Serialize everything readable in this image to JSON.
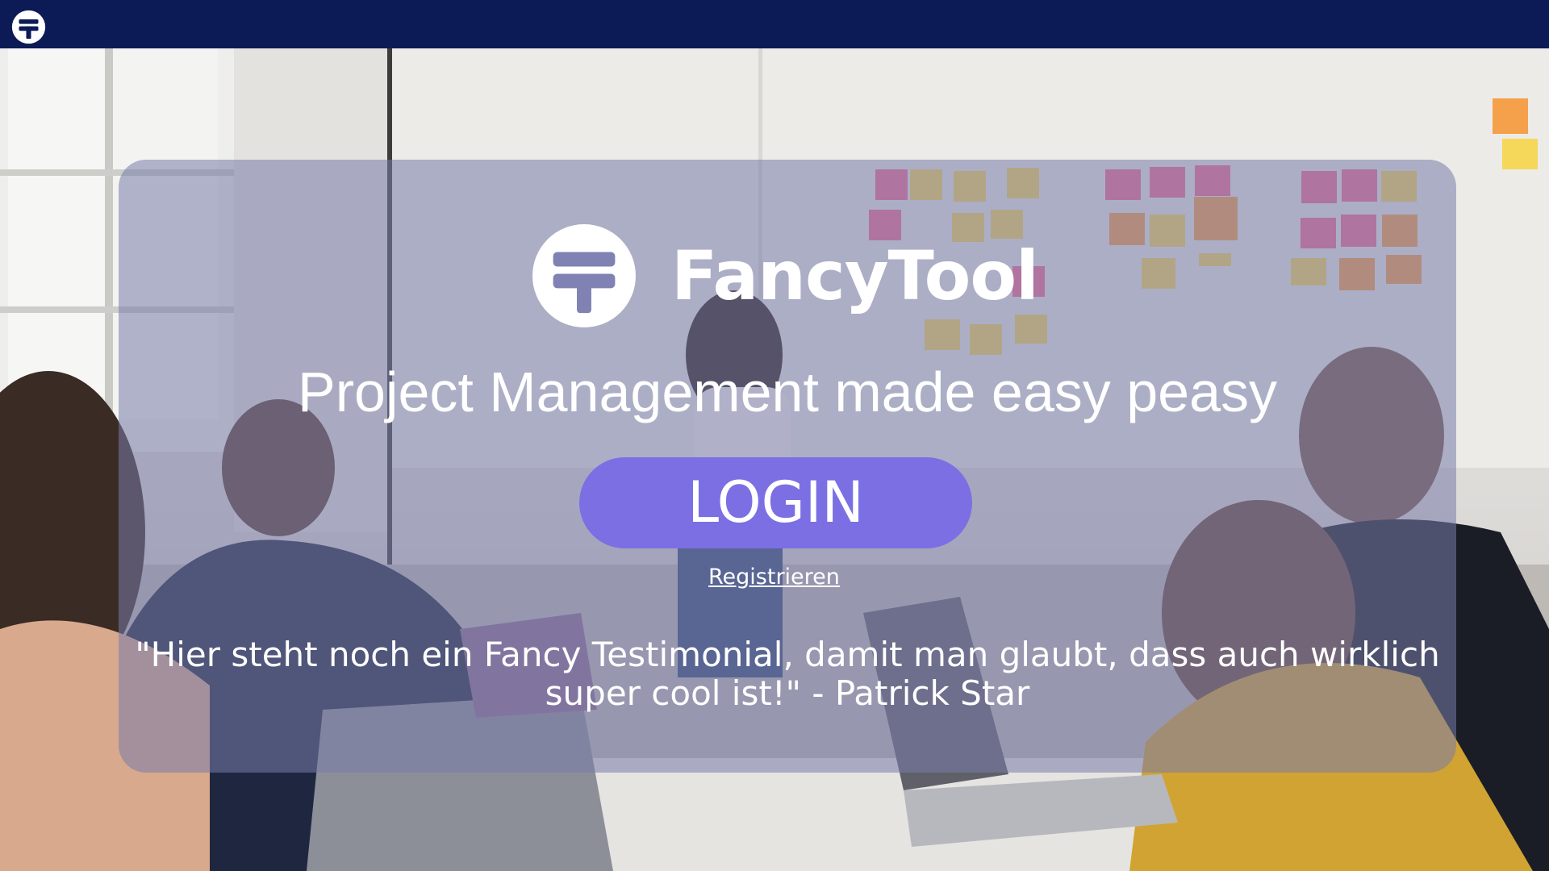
{
  "app": {
    "logo_icon": "fancytool-logo-icon"
  },
  "hero": {
    "brand_name": "FancyTool",
    "tagline": "Project Management made easy peasy",
    "login_label": "LOGIN",
    "register_label": "Registrieren",
    "testimonial": "\"Hier steht noch ein Fancy Testimonial, damit man glaubt, dass auch wirklich super cool ist!\" - Patrick Star"
  },
  "colors": {
    "topbar": "#0c1a55",
    "card_overlay": "rgba(120,124,170,0.55)",
    "login_button": "#7b6fe3",
    "text": "#ffffff"
  }
}
